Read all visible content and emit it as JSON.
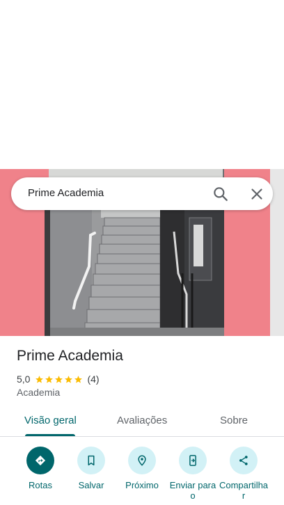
{
  "search": {
    "query": "Prime Academia"
  },
  "place": {
    "name": "Prime Academia",
    "rating": "5,0",
    "stars": 5,
    "review_count": "(4)",
    "category": "Academia"
  },
  "tabs": [
    {
      "label": "Visão geral",
      "active": true
    },
    {
      "label": "Avaliações",
      "active": false
    },
    {
      "label": "Sobre",
      "active": false
    }
  ],
  "actions": [
    {
      "label": "Rotas",
      "icon": "directions-icon"
    },
    {
      "label": "Salvar",
      "icon": "bookmark-icon"
    },
    {
      "label": "Próximo",
      "icon": "nearby-icon"
    },
    {
      "label": "Enviar para o",
      "icon": "send-to-phone-icon"
    },
    {
      "label": "Compartilhar",
      "icon": "share-icon"
    }
  ],
  "colors": {
    "accent": "#00666b",
    "action_bg": "#d2f1f6",
    "star": "#fbbc04",
    "wall_pink": "#f0828a"
  }
}
